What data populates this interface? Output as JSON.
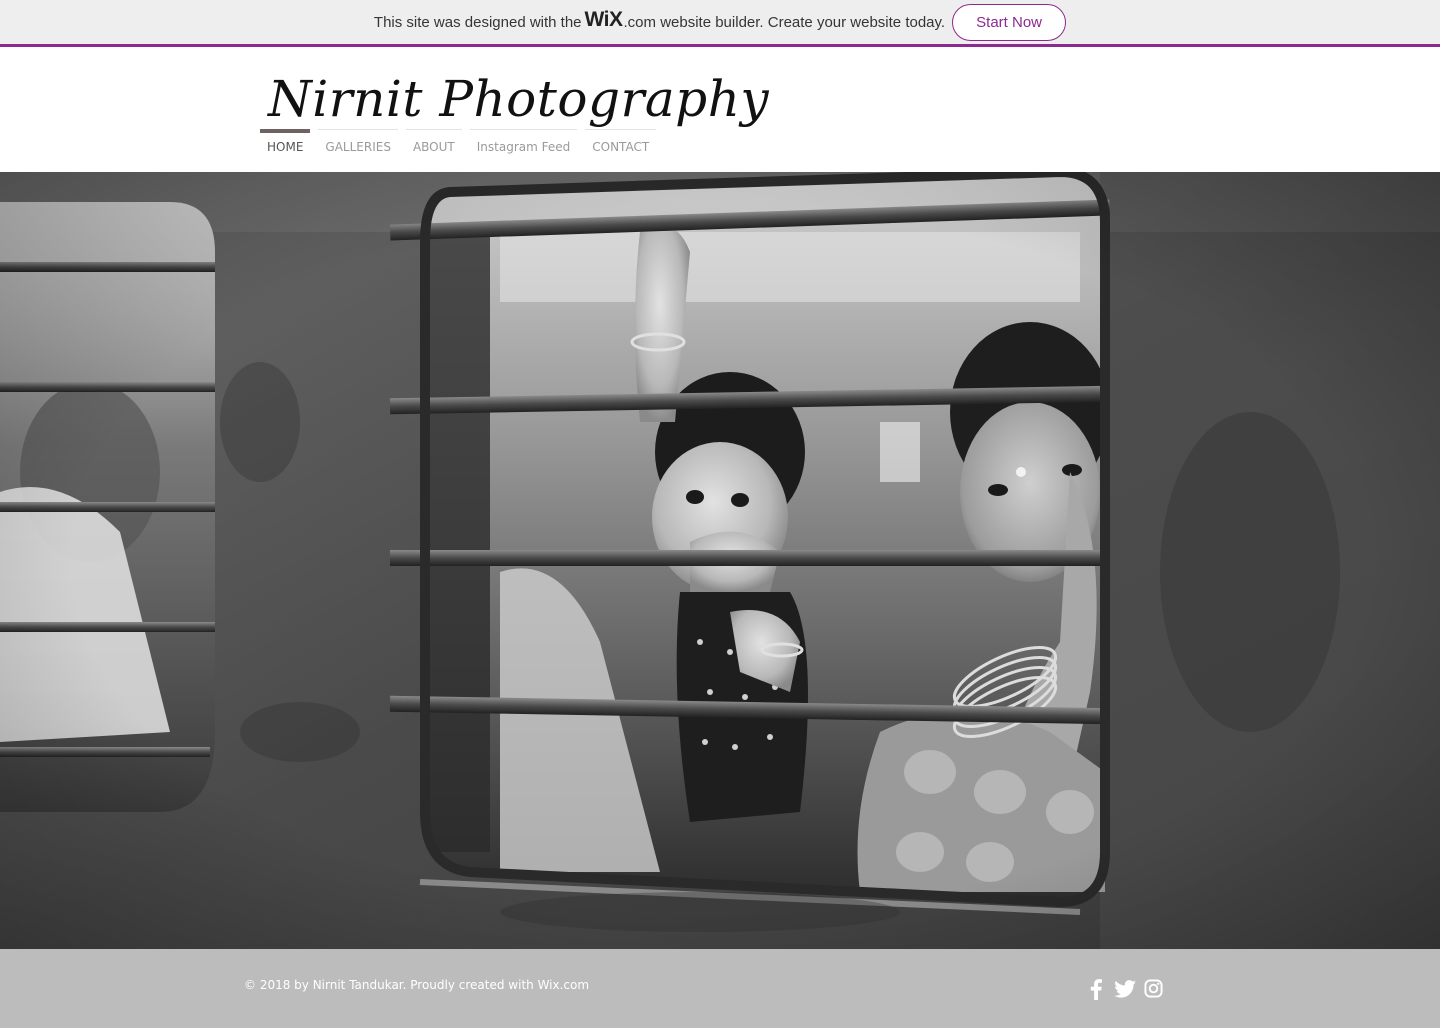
{
  "banner": {
    "text_before": "This site was designed with the",
    "logo": "WiX",
    "text_after": ".com website builder. Create your website today.",
    "button_label": "Start Now",
    "accent_color": "#8c2a8f"
  },
  "header": {
    "site_title": "Nirnit Photography"
  },
  "nav": {
    "items": [
      {
        "label": "HOME",
        "active": true
      },
      {
        "label": "GALLERIES",
        "active": false
      },
      {
        "label": "ABOUT",
        "active": false
      },
      {
        "label": "Instagram Feed",
        "active": false
      },
      {
        "label": "CONTACT",
        "active": false
      }
    ]
  },
  "hero": {
    "image": "black-and-white photo of a child and woman looking out of a barred train window",
    "tone": "grayscale"
  },
  "footer": {
    "copyright": "© 2018 by Nirnit Tandukar. Proudly created with ",
    "link_text": "Wix.com",
    "social": [
      "facebook-icon",
      "twitter-icon",
      "instagram-icon"
    ]
  }
}
